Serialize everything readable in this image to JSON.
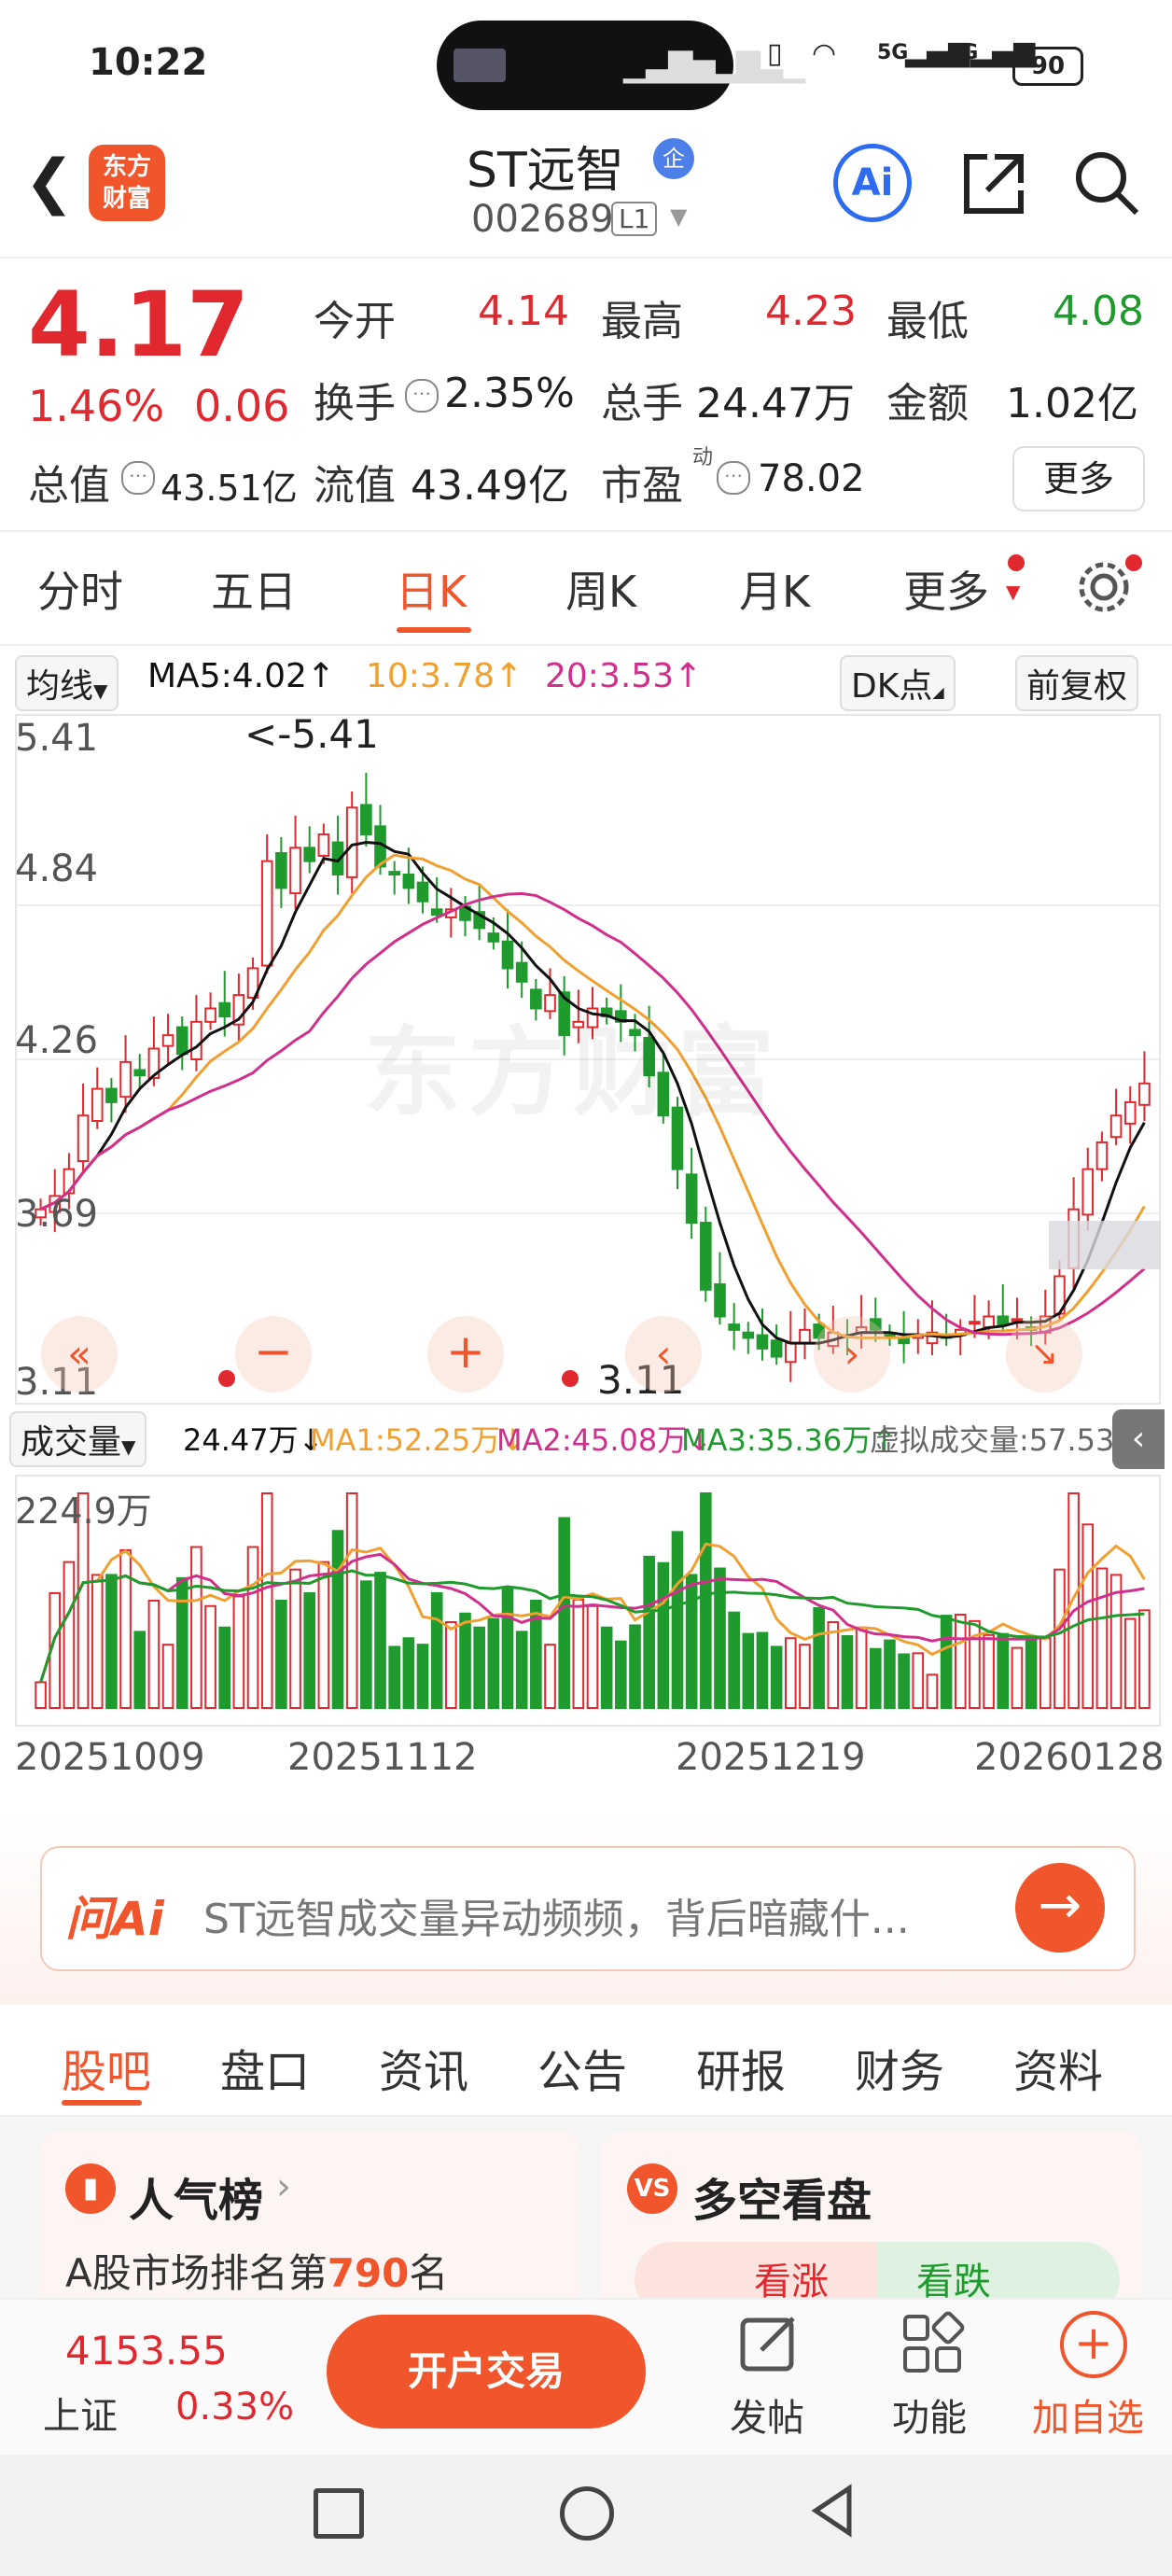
{
  "status": {
    "time": "10:22",
    "battery": "90",
    "net1": "5G",
    "net2": "5G"
  },
  "header": {
    "logo": "东方\n财富",
    "title": "ST远智",
    "title_badge": "企",
    "code": "002689",
    "level": "L1",
    "ai_label": "Ai"
  },
  "quote": {
    "price": "4.17",
    "change_pct": "1.46%",
    "change": "0.06",
    "open_label": "今开",
    "open": "4.14",
    "high_label": "最高",
    "high": "4.23",
    "low_label": "最低",
    "low": "4.08",
    "turnover_label": "换手",
    "turnover": "2.35%",
    "volume_label": "总手",
    "volume": "24.47万",
    "amount_label": "金额",
    "amount": "1.02亿",
    "mktcap_label": "总值",
    "mktcap": "43.51亿",
    "float_label": "流值",
    "float": "43.49亿",
    "pe_label": "市盈",
    "pe_sup": "动",
    "pe": "78.02",
    "more": "更多"
  },
  "tabs": [
    "分时",
    "五日",
    "日K",
    "周K",
    "月K",
    "更多"
  ],
  "chart": {
    "ma_toggle": "均线",
    "ma5": "MA5:4.02↑",
    "ma10": "10:3.78↑",
    "ma20": "20:3.53↑",
    "dk": "DK点",
    "adjust": "前复权",
    "y_ticks": [
      "5.41",
      "4.84",
      "4.26",
      "3.69",
      "3.11"
    ],
    "max_label": "<-5.41",
    "min_label": "3.11",
    "watermark": "东方财富",
    "vol_toggle": "成交量",
    "vol_now": "24.47万↓",
    "vol_ma1": "MA1:52.25万↓",
    "vol_ma2": "MA2:45.08万↓",
    "vol_ma3": "MA3:35.36万↑",
    "vol_virtual": "虚拟成交量:57.53万",
    "vol_max": "224.9万",
    "dates": [
      "20251009",
      "20251112",
      "20251219",
      "20260128"
    ],
    "colors": {
      "up": "#e0282e",
      "down": "#1f9b2e",
      "ma5": "#111111",
      "ma10": "#f0a030",
      "ma20": "#d0308c"
    }
  },
  "chart_data": {
    "type": "candlestick",
    "y_range": [
      3.11,
      5.41
    ],
    "closes": [
      3.7,
      3.75,
      3.85,
      4.05,
      4.15,
      4.1,
      4.25,
      4.2,
      4.3,
      4.35,
      4.28,
      4.4,
      4.45,
      4.42,
      4.5,
      4.6,
      5.0,
      4.9,
      5.05,
      5.0,
      5.1,
      4.95,
      5.2,
      5.1,
      4.98,
      4.95,
      4.9,
      4.85,
      4.8,
      4.82,
      4.78,
      4.75,
      4.7,
      4.6,
      4.55,
      4.45,
      4.5,
      4.35,
      4.4,
      4.45,
      4.42,
      4.4,
      4.35,
      4.2,
      4.05,
      3.85,
      3.65,
      3.4,
      3.3,
      3.25,
      3.22,
      3.18,
      3.15,
      3.2,
      3.25,
      3.22,
      3.24,
      3.23,
      3.26,
      3.25,
      3.22,
      3.2,
      3.23,
      3.24,
      3.22,
      3.25,
      3.28,
      3.3,
      3.27,
      3.29,
      3.25,
      3.3,
      3.45,
      3.7,
      3.85,
      3.95,
      4.05,
      4.1,
      4.17
    ],
    "ma5_last": 4.02,
    "ma10_last": 3.78,
    "ma20_last": 3.53,
    "volume_max": "224.9万"
  },
  "ask_ai": {
    "brand": "问Ai",
    "text": "ST远智成交量异动频频，背后暗藏什..."
  },
  "sub_tabs": [
    "股吧",
    "盘口",
    "资讯",
    "公告",
    "研报",
    "财务",
    "资料"
  ],
  "cards": {
    "popularity_title": "人气榜",
    "rank_text": "A股市场排名第",
    "rank": "790",
    "rank_unit": "名",
    "debate_title": "多空看盘",
    "bull": "看涨",
    "bear": "看跌"
  },
  "bottom": {
    "index_value": "4153.55",
    "index_name": "上证",
    "index_change": "0.33%",
    "open_account": "开户交易",
    "post": "发帖",
    "functions": "功能",
    "add_fav": "加自选"
  }
}
